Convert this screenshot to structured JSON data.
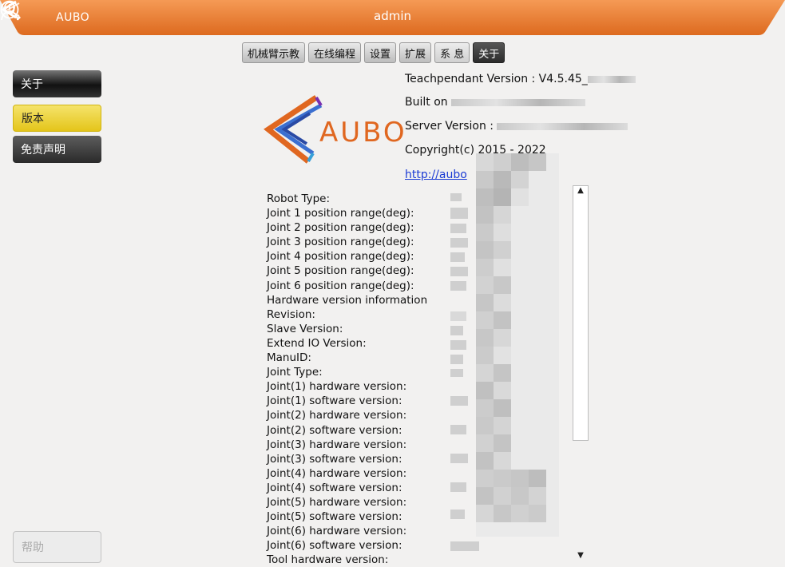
{
  "titlebar": {
    "brand": "AUBO",
    "user": "admin"
  },
  "tabs": [
    {
      "label": "机械臂示教",
      "active": false
    },
    {
      "label": "在线编程",
      "active": false
    },
    {
      "label": "设置",
      "active": false
    },
    {
      "label": "扩展",
      "active": false
    },
    {
      "label": "系   息",
      "active": false
    },
    {
      "label": "关于",
      "active": true
    }
  ],
  "sidebar": {
    "header": "关于",
    "items": [
      {
        "label": "版本",
        "selected": true
      },
      {
        "label": "免责声明",
        "selected": false
      }
    ],
    "help": "帮助"
  },
  "logo": {
    "brand": "AUBO"
  },
  "info": {
    "teachpendant": "Teachpendant Version : V4.5.45_",
    "built_on": "Built on",
    "server_version": "Server Version :",
    "copyright": "Copyright(c) 2015 - 2022",
    "link": "http://aubo"
  },
  "robot_info_labels": [
    "Robot Type:",
    "Joint 1 position range(deg):",
    "Joint 2 position range(deg):",
    "Joint 3 position range(deg):",
    "Joint 4 position range(deg):",
    "Joint 5 position range(deg):",
    "Joint 6 position range(deg):",
    "Hardware version information",
    "Revision:",
    "Slave Version:",
    "Extend IO Version:",
    "ManuID:",
    "Joint Type:",
    "Joint(1) hardware version:",
    "Joint(1) software version:",
    "Joint(2) hardware version:",
    "Joint(2) software version:",
    "Joint(3) hardware version:",
    "Joint(3) software version:",
    "Joint(4) hardware version:",
    "Joint(4) software version:",
    "Joint(5) hardware version:",
    "Joint(5) software version:",
    "Joint(6) hardware version:",
    "Joint(6) software version:",
    "Tool hardware version:"
  ],
  "colors": {
    "titlebar": "#e8772a",
    "accent_yellow": "#e6c61d",
    "brand_orange": "#e06720",
    "link": "#1a3ad4"
  }
}
